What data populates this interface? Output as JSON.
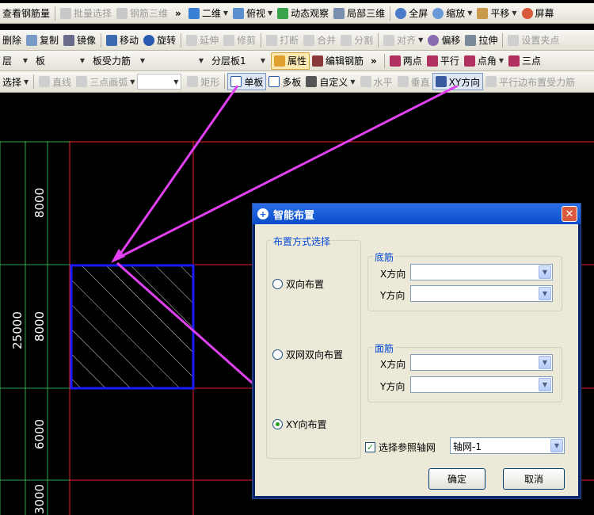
{
  "toolbar1": {
    "items": [
      "查看钢筋量",
      "批量选择",
      "钢筋三维",
      "二维",
      "俯视",
      "动态观察",
      "局部三维",
      "全屏",
      "缩放",
      "平移",
      "屏幕"
    ],
    "more": "»"
  },
  "toolbar2": {
    "items": [
      "删除",
      "复制",
      "镜像",
      "移动",
      "旋转",
      "延伸",
      "修剪",
      "打断",
      "合并",
      "分割",
      "对齐",
      "偏移",
      "拉伸",
      "设置夹点"
    ]
  },
  "toolbar3": {
    "layer": "层",
    "category": "板",
    "type": "板受力筋",
    "name": "",
    "sublayer": "分层板1",
    "properties": "属性",
    "edit_rebar": "编辑钢筋",
    "more": "»",
    "two_points": "两点",
    "parallel": "平行",
    "point_angle": "点角",
    "three_points": "三点"
  },
  "toolbar4": {
    "select": "选择",
    "line": "直线",
    "arc": "三点画弧",
    "rect": "矩形",
    "single_slab": "单板",
    "multi_slab": "多板",
    "custom": "自定义",
    "horizontal": "水平",
    "vertical": "垂直",
    "xy_dir": "XY方向",
    "parallel_edge": "平行边布置受力筋"
  },
  "canvas": {
    "dims": [
      "8000",
      "25000",
      "8000",
      "6000",
      "3000"
    ],
    "colors": {
      "grid": "#e8202a",
      "green": "#2ea84a",
      "slab": "#1a1aff",
      "arrow": "#e040f0"
    }
  },
  "dialog": {
    "title": "智能布置",
    "group_method": "布置方式选择",
    "radio_bidirectional": "双向布置",
    "radio_double_net": "双网双向布置",
    "radio_xy": "XY向布置",
    "group_bottom": "底筋",
    "group_top": "面筋",
    "x_dir": "X方向",
    "y_dir": "Y方向",
    "checkbox_axis": "选择参照轴网",
    "axis_value": "轴网-1",
    "ok": "确定",
    "cancel": "取消"
  }
}
